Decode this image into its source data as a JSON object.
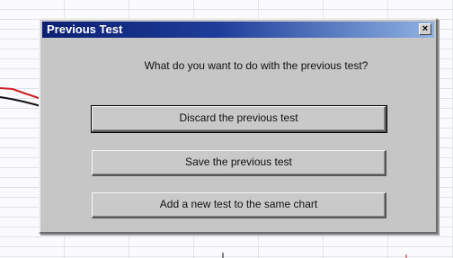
{
  "dialog": {
    "title": "Previous Test",
    "close_label": "×",
    "prompt": "What do you want to do with the previous test?",
    "buttons": [
      {
        "label": "Discard the previous test"
      },
      {
        "label": "Save the previous test"
      },
      {
        "label": "Add a new test to the same chart"
      }
    ]
  },
  "colors": {
    "titlebar_start": "#0c2072",
    "titlebar_end": "#8fb2e3",
    "dialog_face": "#c6c6c6",
    "chart_line_red": "#d02020",
    "chart_line_black": "#111111"
  }
}
